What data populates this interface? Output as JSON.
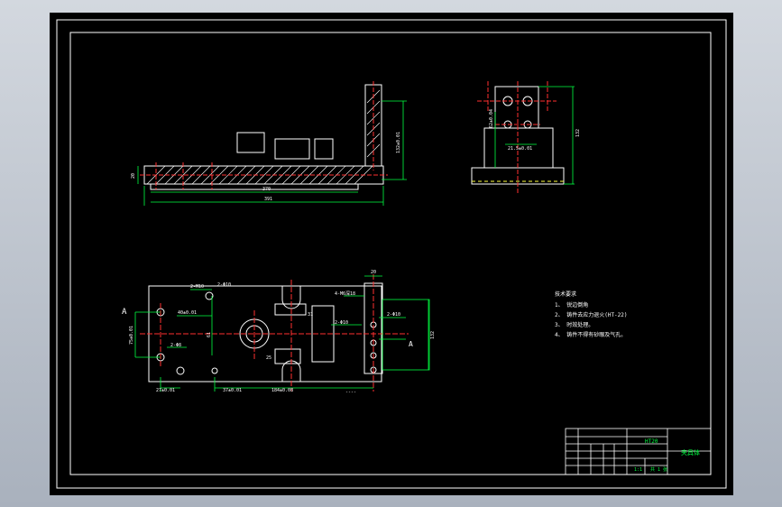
{
  "drawing": {
    "view_label_a": "A",
    "front_view": {
      "dim_width_inner": "370",
      "dim_width_outer": "391",
      "dim_height_right": "132±0.01",
      "dim_left": "20"
    },
    "side_view": {
      "dim_center_height": "62±0.04",
      "dim_bottom": "21.5±0.01",
      "dim_right": "132"
    },
    "top_view": {
      "label_2_m10": "2-M10",
      "label_2_phi10_a": "2-Φ10",
      "label_2_phi8": "2-Φ8",
      "label_2_m8": "2-M8",
      "label_4_m6": "4-M6深18",
      "label_2_phi10_b": "2-Φ10",
      "label_2_phi10_c": "2-Φ10",
      "label_40": "40±0.01",
      "label_37": "37±0.01",
      "label_61": "61",
      "label_75": "75±0.01",
      "label_27": "27±0.01",
      "label_184": "184±0.08",
      "label_top_right": "20",
      "label_right_a": "A",
      "label_right_dim": "132",
      "label_31": "31",
      "label_25": "25",
      "label_bottom_far": "----"
    }
  },
  "notes": {
    "title": "技术要求",
    "items": [
      "1、 锐边倒角",
      "2、 铸件去应力退火(HT-22)",
      "3、 时效处理。",
      "4、 铸件不得有砂眼及气孔。"
    ]
  },
  "title_block": {
    "part_name": "夹具体",
    "material": "HT20",
    "scale": "1:1",
    "sheet": "共 1 张"
  }
}
